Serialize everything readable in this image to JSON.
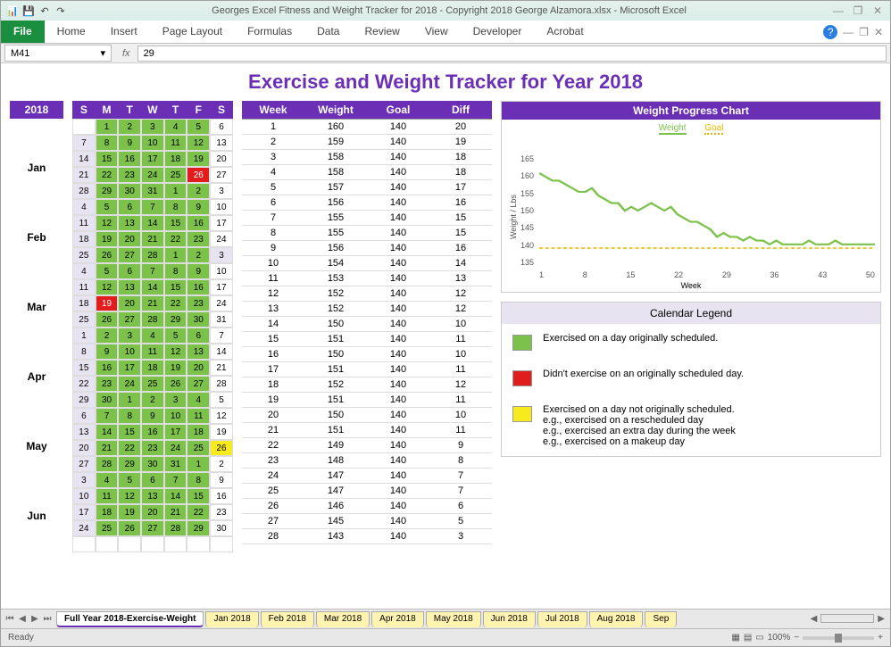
{
  "app": {
    "title": "Georges Excel Fitness and Weight Tracker for 2018 - Copyright 2018 George Alzamora.xlsx  -  Microsoft Excel",
    "file_tab": "File",
    "tabs": [
      "Home",
      "Insert",
      "Page Layout",
      "Formulas",
      "Data",
      "Review",
      "View",
      "Developer",
      "Acrobat"
    ]
  },
  "formula": {
    "name_box": "M41",
    "fx": "fx",
    "value": "29"
  },
  "sheet": {
    "title": "Exercise and Weight Tracker for Year 2018",
    "year": "2018",
    "months": [
      "Jan",
      "Feb",
      "Mar",
      "Apr",
      "May",
      "Jun"
    ],
    "dow": [
      "S",
      "M",
      "T",
      "W",
      "T",
      "F",
      "S"
    ],
    "cal": [
      [
        [
          "",
          "w"
        ],
        [
          "1",
          "g"
        ],
        [
          "2",
          "g"
        ],
        [
          "3",
          "g"
        ],
        [
          "4",
          "g"
        ],
        [
          "5",
          "g"
        ],
        [
          "6",
          "w"
        ]
      ],
      [
        [
          "7",
          "l"
        ],
        [
          "8",
          "g"
        ],
        [
          "9",
          "g"
        ],
        [
          "10",
          "g"
        ],
        [
          "11",
          "g"
        ],
        [
          "12",
          "g"
        ],
        [
          "13",
          "w"
        ]
      ],
      [
        [
          "14",
          "l"
        ],
        [
          "15",
          "g"
        ],
        [
          "16",
          "g"
        ],
        [
          "17",
          "g"
        ],
        [
          "18",
          "g"
        ],
        [
          "19",
          "g"
        ],
        [
          "20",
          "w"
        ]
      ],
      [
        [
          "21",
          "l"
        ],
        [
          "22",
          "g"
        ],
        [
          "23",
          "g"
        ],
        [
          "24",
          "g"
        ],
        [
          "25",
          "g"
        ],
        [
          "26",
          "r"
        ],
        [
          "27",
          "w"
        ]
      ],
      [
        [
          "28",
          "l"
        ],
        [
          "29",
          "g"
        ],
        [
          "30",
          "g"
        ],
        [
          "31",
          "g"
        ],
        [
          "1",
          "g"
        ],
        [
          "2",
          "g"
        ],
        [
          "3",
          "w"
        ]
      ],
      [
        [
          "4",
          "l"
        ],
        [
          "5",
          "g"
        ],
        [
          "6",
          "g"
        ],
        [
          "7",
          "g"
        ],
        [
          "8",
          "g"
        ],
        [
          "9",
          "g"
        ],
        [
          "10",
          "w"
        ]
      ],
      [
        [
          "11",
          "l"
        ],
        [
          "12",
          "g"
        ],
        [
          "13",
          "g"
        ],
        [
          "14",
          "g"
        ],
        [
          "15",
          "g"
        ],
        [
          "16",
          "g"
        ],
        [
          "17",
          "w"
        ]
      ],
      [
        [
          "18",
          "l"
        ],
        [
          "19",
          "g"
        ],
        [
          "20",
          "g"
        ],
        [
          "21",
          "g"
        ],
        [
          "22",
          "g"
        ],
        [
          "23",
          "g"
        ],
        [
          "24",
          "w"
        ]
      ],
      [
        [
          "25",
          "l"
        ],
        [
          "26",
          "g"
        ],
        [
          "27",
          "g"
        ],
        [
          "28",
          "g"
        ],
        [
          "1",
          "g"
        ],
        [
          "2",
          "g"
        ],
        [
          "3",
          "l"
        ]
      ],
      [
        [
          "4",
          "l"
        ],
        [
          "5",
          "g"
        ],
        [
          "6",
          "g"
        ],
        [
          "7",
          "g"
        ],
        [
          "8",
          "g"
        ],
        [
          "9",
          "g"
        ],
        [
          "10",
          "w"
        ]
      ],
      [
        [
          "11",
          "l"
        ],
        [
          "12",
          "g"
        ],
        [
          "13",
          "g"
        ],
        [
          "14",
          "g"
        ],
        [
          "15",
          "g"
        ],
        [
          "16",
          "g"
        ],
        [
          "17",
          "w"
        ]
      ],
      [
        [
          "18",
          "l"
        ],
        [
          "19",
          "r"
        ],
        [
          "20",
          "g"
        ],
        [
          "21",
          "g"
        ],
        [
          "22",
          "g"
        ],
        [
          "23",
          "g"
        ],
        [
          "24",
          "w"
        ]
      ],
      [
        [
          "25",
          "l"
        ],
        [
          "26",
          "g"
        ],
        [
          "27",
          "g"
        ],
        [
          "28",
          "g"
        ],
        [
          "29",
          "g"
        ],
        [
          "30",
          "g"
        ],
        [
          "31",
          "w"
        ]
      ],
      [
        [
          "1",
          "l"
        ],
        [
          "2",
          "g"
        ],
        [
          "3",
          "g"
        ],
        [
          "4",
          "g"
        ],
        [
          "5",
          "g"
        ],
        [
          "6",
          "g"
        ],
        [
          "7",
          "w"
        ]
      ],
      [
        [
          "8",
          "l"
        ],
        [
          "9",
          "g"
        ],
        [
          "10",
          "g"
        ],
        [
          "11",
          "g"
        ],
        [
          "12",
          "g"
        ],
        [
          "13",
          "g"
        ],
        [
          "14",
          "w"
        ]
      ],
      [
        [
          "15",
          "l"
        ],
        [
          "16",
          "g"
        ],
        [
          "17",
          "g"
        ],
        [
          "18",
          "g"
        ],
        [
          "19",
          "g"
        ],
        [
          "20",
          "g"
        ],
        [
          "21",
          "w"
        ]
      ],
      [
        [
          "22",
          "l"
        ],
        [
          "23",
          "g"
        ],
        [
          "24",
          "g"
        ],
        [
          "25",
          "g"
        ],
        [
          "26",
          "g"
        ],
        [
          "27",
          "g"
        ],
        [
          "28",
          "w"
        ]
      ],
      [
        [
          "29",
          "l"
        ],
        [
          "30",
          "g"
        ],
        [
          "1",
          "g"
        ],
        [
          "2",
          "g"
        ],
        [
          "3",
          "g"
        ],
        [
          "4",
          "g"
        ],
        [
          "5",
          "w"
        ]
      ],
      [
        [
          "6",
          "l"
        ],
        [
          "7",
          "g"
        ],
        [
          "8",
          "g"
        ],
        [
          "9",
          "g"
        ],
        [
          "10",
          "g"
        ],
        [
          "11",
          "g"
        ],
        [
          "12",
          "w"
        ]
      ],
      [
        [
          "13",
          "l"
        ],
        [
          "14",
          "g"
        ],
        [
          "15",
          "g"
        ],
        [
          "16",
          "g"
        ],
        [
          "17",
          "g"
        ],
        [
          "18",
          "g"
        ],
        [
          "19",
          "w"
        ]
      ],
      [
        [
          "20",
          "l"
        ],
        [
          "21",
          "g"
        ],
        [
          "22",
          "g"
        ],
        [
          "23",
          "g"
        ],
        [
          "24",
          "g"
        ],
        [
          "25",
          "g"
        ],
        [
          "26",
          "y"
        ]
      ],
      [
        [
          "27",
          "l"
        ],
        [
          "28",
          "g"
        ],
        [
          "29",
          "g"
        ],
        [
          "30",
          "g"
        ],
        [
          "31",
          "g"
        ],
        [
          "1",
          "g"
        ],
        [
          "2",
          "w"
        ]
      ],
      [
        [
          "3",
          "l"
        ],
        [
          "4",
          "g"
        ],
        [
          "5",
          "g"
        ],
        [
          "6",
          "g"
        ],
        [
          "7",
          "g"
        ],
        [
          "8",
          "g"
        ],
        [
          "9",
          "w"
        ]
      ],
      [
        [
          "10",
          "l"
        ],
        [
          "11",
          "g"
        ],
        [
          "12",
          "g"
        ],
        [
          "13",
          "g"
        ],
        [
          "14",
          "g"
        ],
        [
          "15",
          "g"
        ],
        [
          "16",
          "w"
        ]
      ],
      [
        [
          "17",
          "l"
        ],
        [
          "18",
          "g"
        ],
        [
          "19",
          "g"
        ],
        [
          "20",
          "g"
        ],
        [
          "21",
          "g"
        ],
        [
          "22",
          "g"
        ],
        [
          "23",
          "w"
        ]
      ],
      [
        [
          "24",
          "l"
        ],
        [
          "25",
          "g"
        ],
        [
          "26",
          "g"
        ],
        [
          "27",
          "g"
        ],
        [
          "28",
          "g"
        ],
        [
          "29",
          "g"
        ],
        [
          "30",
          "w"
        ]
      ],
      [
        [
          "",
          "w"
        ],
        [
          "",
          "w"
        ],
        [
          "",
          "w"
        ],
        [
          "",
          "w"
        ],
        [
          "",
          "w"
        ],
        [
          "",
          "w"
        ],
        [
          "",
          "w"
        ]
      ]
    ],
    "wk_headers": [
      "Week",
      "Weight",
      "Goal",
      "Diff"
    ],
    "weeks": [
      [
        1,
        160,
        140,
        20
      ],
      [
        2,
        159,
        140,
        19
      ],
      [
        3,
        158,
        140,
        18
      ],
      [
        4,
        158,
        140,
        18
      ],
      [
        5,
        157,
        140,
        17
      ],
      [
        6,
        156,
        140,
        16
      ],
      [
        7,
        155,
        140,
        15
      ],
      [
        8,
        155,
        140,
        15
      ],
      [
        9,
        156,
        140,
        16
      ],
      [
        10,
        154,
        140,
        14
      ],
      [
        11,
        153,
        140,
        13
      ],
      [
        12,
        152,
        140,
        12
      ],
      [
        13,
        152,
        140,
        12
      ],
      [
        14,
        150,
        140,
        10
      ],
      [
        15,
        151,
        140,
        11
      ],
      [
        16,
        150,
        140,
        10
      ],
      [
        17,
        151,
        140,
        11
      ],
      [
        18,
        152,
        140,
        12
      ],
      [
        19,
        151,
        140,
        11
      ],
      [
        20,
        150,
        140,
        10
      ],
      [
        21,
        151,
        140,
        11
      ],
      [
        22,
        149,
        140,
        9
      ],
      [
        23,
        148,
        140,
        8
      ],
      [
        24,
        147,
        140,
        7
      ],
      [
        25,
        147,
        140,
        7
      ],
      [
        26,
        146,
        140,
        6
      ],
      [
        27,
        145,
        140,
        5
      ],
      [
        28,
        143,
        140,
        3
      ]
    ],
    "chart": {
      "title": "Weight Progress Chart",
      "legend_w": "Weight",
      "legend_g": "Goal",
      "ylabel": "Weight / Lbs",
      "xlabel": "Week",
      "yticks": [
        "165",
        "160",
        "155",
        "150",
        "145",
        "140",
        "135"
      ],
      "xticks": [
        "1",
        "8",
        "15",
        "22",
        "29",
        "36",
        "43",
        "50"
      ]
    },
    "legend": {
      "title": "Calendar Legend",
      "green": "Exercised on a day originally scheduled.",
      "red": "Didn't exercise on an originally scheduled day.",
      "yellow_l1": "Exercised on a day not originally scheduled.",
      "yellow_l2": "e.g., exercised on a rescheduled day",
      "yellow_l3": "e.g., exercised an extra day during the week",
      "yellow_l4": "e.g., exercised on a makeup day"
    }
  },
  "tabs": [
    "Full Year 2018-Exercise-Weight",
    "Jan 2018",
    "Feb 2018",
    "Mar 2018",
    "Apr 2018",
    "May 2018",
    "Jun 2018",
    "Jul 2018",
    "Aug 2018",
    "Sep"
  ],
  "status": {
    "ready": "Ready",
    "zoom": "100%"
  },
  "chart_data": {
    "type": "line",
    "title": "Weight Progress Chart",
    "xlabel": "Week",
    "ylabel": "Weight / Lbs",
    "ylim": [
      135,
      165
    ],
    "x": [
      1,
      2,
      3,
      4,
      5,
      6,
      7,
      8,
      9,
      10,
      11,
      12,
      13,
      14,
      15,
      16,
      17,
      18,
      19,
      20,
      21,
      22,
      23,
      24,
      25,
      26,
      27,
      28,
      29,
      30,
      31,
      32,
      33,
      34,
      35,
      36,
      37,
      38,
      39,
      40,
      41,
      42,
      43,
      44,
      45,
      46,
      47,
      48,
      49,
      50,
      51,
      52
    ],
    "series": [
      {
        "name": "Weight",
        "values": [
          160,
          159,
          158,
          158,
          157,
          156,
          155,
          155,
          156,
          154,
          153,
          152,
          152,
          150,
          151,
          150,
          151,
          152,
          151,
          150,
          151,
          149,
          148,
          147,
          147,
          146,
          145,
          143,
          144,
          143,
          143,
          142,
          143,
          142,
          142,
          141,
          142,
          141,
          141,
          141,
          141,
          142,
          141,
          141,
          141,
          142,
          141,
          141,
          141,
          141,
          141,
          141
        ]
      },
      {
        "name": "Goal",
        "values": [
          140,
          140,
          140,
          140,
          140,
          140,
          140,
          140,
          140,
          140,
          140,
          140,
          140,
          140,
          140,
          140,
          140,
          140,
          140,
          140,
          140,
          140,
          140,
          140,
          140,
          140,
          140,
          140,
          140,
          140,
          140,
          140,
          140,
          140,
          140,
          140,
          140,
          140,
          140,
          140,
          140,
          140,
          140,
          140,
          140,
          140,
          140,
          140,
          140,
          140,
          140,
          140
        ]
      }
    ]
  }
}
